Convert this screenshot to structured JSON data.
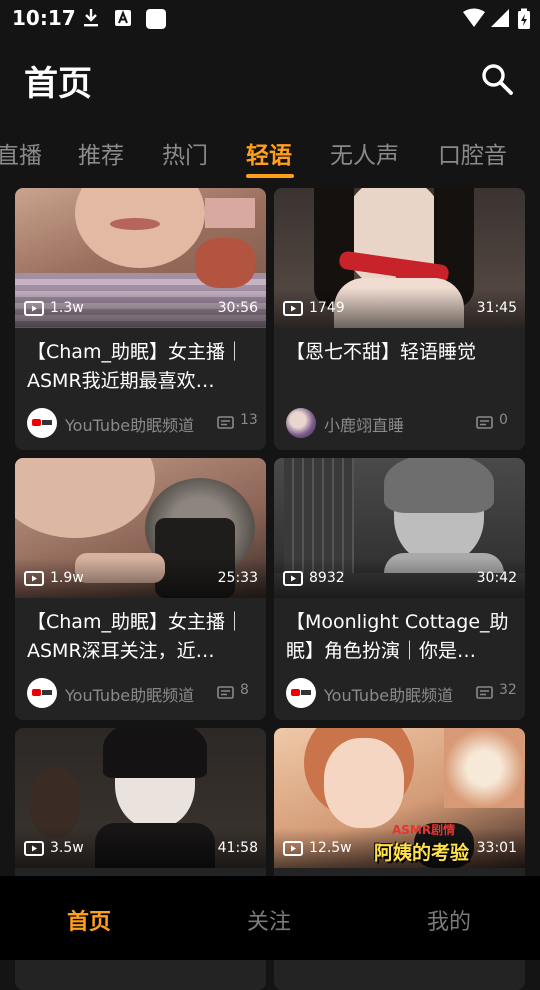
{
  "status_bar": {
    "time": "10:17"
  },
  "header": {
    "title": "首页"
  },
  "tabs": [
    {
      "label": "直播"
    },
    {
      "label": "推荐"
    },
    {
      "label": "热门"
    },
    {
      "label": "轻语",
      "active": true
    },
    {
      "label": "无人声"
    },
    {
      "label": "口腔音"
    }
  ],
  "videos": [
    {
      "views": "1.3w",
      "duration": "30:56",
      "title": "【Cham_助眠】女主播｜ASMR我近期最喜欢…",
      "author": "YouTube助眠频道",
      "comments": "13",
      "avatar": "youtube"
    },
    {
      "views": "1749",
      "duration": "31:45",
      "title": "【恩七不甜】轻语睡觉",
      "author": "小鹿翊直睡",
      "comments": "0",
      "avatar": "photo"
    },
    {
      "views": "1.9w",
      "duration": "25:33",
      "title": "【Cham_助眠】女主播｜ASMR深耳关注，近…",
      "author": "YouTube助眠频道",
      "comments": "8",
      "avatar": "youtube"
    },
    {
      "views": "8932",
      "duration": "30:42",
      "title": "【Moonlight Cottage_助眠】角色扮演｜你是…",
      "author": "YouTube助眠频道",
      "comments": "32",
      "avatar": "youtube"
    },
    {
      "views": "3.5w",
      "duration": "41:58",
      "title": "",
      "author": "",
      "comments": ""
    },
    {
      "views": "12.5w",
      "duration": "33:01",
      "title": "",
      "author": "",
      "comments": "",
      "overlay_tag": "ASMR剧情",
      "overlay_caption": "阿姨的考验"
    }
  ],
  "bottom_nav": [
    {
      "label": "首页",
      "active": true
    },
    {
      "label": "关注"
    },
    {
      "label": "我的"
    }
  ],
  "colors": {
    "accent": "#ff9f1c",
    "background": "#141414",
    "card": "#232323",
    "muted": "#8a8a8a"
  }
}
